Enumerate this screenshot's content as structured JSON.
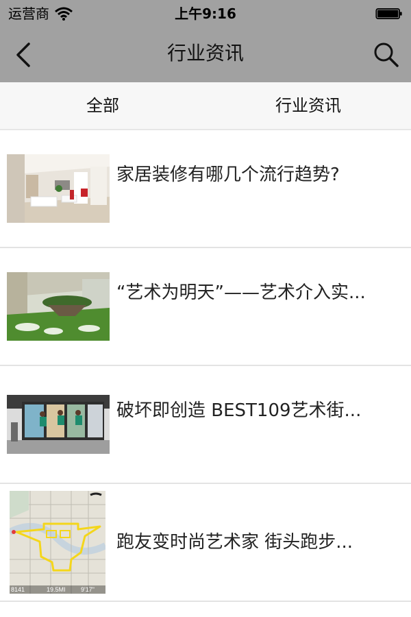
{
  "status_bar": {
    "carrier": "运营商",
    "time": "上午9:16"
  },
  "nav": {
    "title": "行业资讯",
    "back_icon": "chevron-left-icon",
    "search_icon": "search-icon"
  },
  "tabs": [
    {
      "label": "全部"
    },
    {
      "label": "行业资讯"
    }
  ],
  "articles": [
    {
      "title": "家居装修有哪几个流行趋势?"
    },
    {
      "title": "“艺术为明天”——艺术介入实..."
    },
    {
      "title": "破坏即创造 BEST109艺术街..."
    },
    {
      "title": "跑友变时尚艺术家 街头跑步..."
    }
  ],
  "map_overlay": {
    "stat1": "8141",
    "stat2": "19.5MI",
    "stat3": "9'17\""
  },
  "colors": {
    "bar": "#a1a1a1",
    "tab_bg": "#f7f7f7",
    "divider": "#e3e3e3"
  }
}
